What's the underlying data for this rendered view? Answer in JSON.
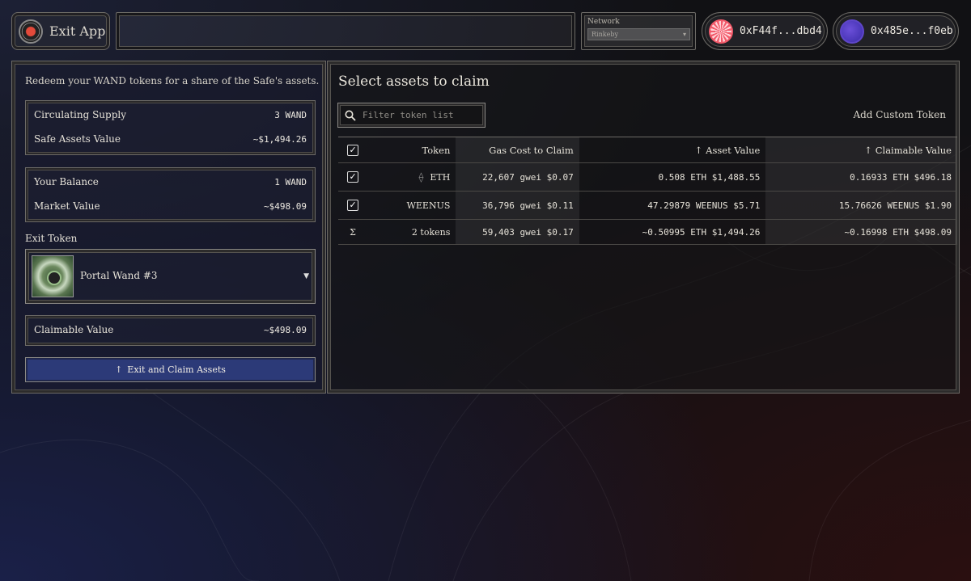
{
  "header": {
    "exit_app_label": "Exit App",
    "network": {
      "label": "Network",
      "selected": "Rinkeby"
    },
    "accounts": [
      {
        "address": "0xF44f...dbd4"
      },
      {
        "address": "0x485e...f0eb"
      }
    ]
  },
  "left_panel": {
    "intro": "Redeem your WAND tokens for a share of the Safe's assets.",
    "supply": {
      "circulating_label": "Circulating Supply",
      "circulating_value": "3 WAND",
      "safe_assets_label": "Safe Assets Value",
      "safe_assets_value": "~$1,494.26"
    },
    "balance": {
      "your_balance_label": "Your Balance",
      "your_balance_value": "1 WAND",
      "market_value_label": "Market Value",
      "market_value_value": "~$498.09"
    },
    "exit_token_label": "Exit Token",
    "exit_token_selected": "Portal Wand #3",
    "claimable": {
      "label": "Claimable Value",
      "value": "~$498.09"
    },
    "claim_button": "Exit and Claim Assets"
  },
  "right_panel": {
    "title": "Select assets to claim",
    "filter_placeholder": "Filter token list",
    "add_custom_token": "Add Custom Token",
    "columns": {
      "token": "Token",
      "gas": "Gas Cost to Claim",
      "asset_value": "Asset Value",
      "claimable_value": "Claimable Value"
    },
    "rows": [
      {
        "token": "ETH",
        "gas": "22,607 gwei $0.07",
        "asset_value": "0.508 ETH $1,488.55",
        "claimable": "0.16933 ETH $496.18",
        "checked": true
      },
      {
        "token": "WEENUS",
        "gas": "36,796 gwei $0.11",
        "asset_value": "47.29879 WEENUS $5.71",
        "claimable": "15.76626 WEENUS $1.90",
        "checked": true
      }
    ],
    "summary": {
      "symbol": "Σ",
      "token": "2 tokens",
      "gas": "59,403 gwei $0.17",
      "asset_value": "~0.50995 ETH $1,494.26",
      "claimable": "~0.16998 ETH $498.09"
    }
  },
  "colors": {
    "claim_button": "#2c3a78",
    "border": "#6c6a66",
    "avatar_1": "#f25a6a",
    "avatar_2": "#5e46c9"
  }
}
